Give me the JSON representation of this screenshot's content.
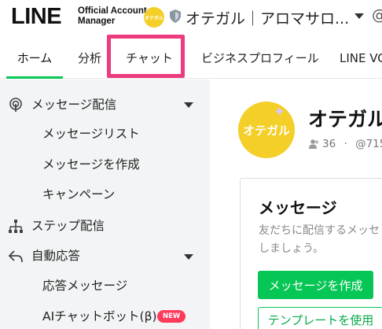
{
  "header": {
    "logo_main": "LINE",
    "logo_sub_line1": "Official Account",
    "logo_sub_line2": "Manager",
    "account_avatar_text": "オテガル",
    "account_name": "オテガル｜アロマサロ...",
    "at_symbol": "@"
  },
  "tabs": [
    {
      "label": "ホーム",
      "active": true
    },
    {
      "label": "分析",
      "active": false
    },
    {
      "label": "チャット",
      "active": false,
      "highlighted": true
    },
    {
      "label": "ビジネスプロフィール",
      "active": false
    },
    {
      "label": "LINE VO",
      "active": false
    }
  ],
  "sidebar": {
    "items": [
      {
        "label": "メッセージ配信",
        "icon": "broadcast-icon",
        "expandable": true
      },
      {
        "label": "メッセージリスト"
      },
      {
        "label": "メッセージを作成"
      },
      {
        "label": "キャンペーン"
      },
      {
        "label": "ステップ配信",
        "icon": "step-flow-icon"
      },
      {
        "label": "自動応答",
        "icon": "reply-icon",
        "expandable": true
      },
      {
        "label": "応答メッセージ"
      },
      {
        "label": "AIチャットボット(β)",
        "badge": "NEW"
      }
    ]
  },
  "main": {
    "avatar_text": "オテガル",
    "account_title": "オテガル",
    "friends_count": "36",
    "separator": "·",
    "account_id": "@715",
    "card": {
      "title": "メッセージ",
      "description": "友だちに配信するメッセ しましょう。",
      "primary_button": "メッセージを作成",
      "secondary_button": "テンプレートを使用"
    }
  },
  "colors": {
    "brand_green": "#06c755",
    "highlight_pink": "#ec3b7e",
    "avatar_yellow": "#f4cf27",
    "new_badge": "#ff3b5c"
  }
}
